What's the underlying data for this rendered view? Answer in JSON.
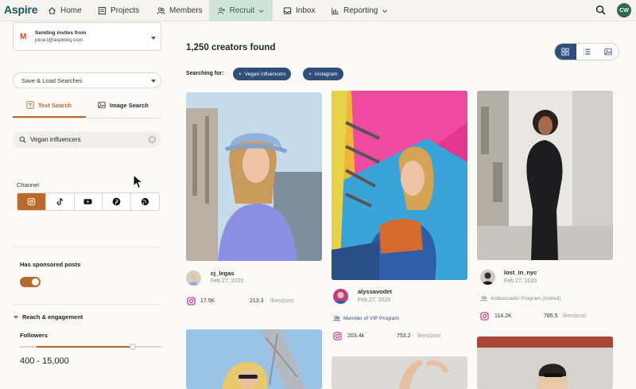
{
  "nav": {
    "brand": "Aspire",
    "items": [
      {
        "label": "Home"
      },
      {
        "label": "Projects"
      },
      {
        "label": "Members"
      },
      {
        "label": "Recruit"
      },
      {
        "label": "Inbox"
      },
      {
        "label": "Reporting"
      }
    ],
    "user_initials": "CW"
  },
  "sidebar": {
    "sender_title": "Sending invites from",
    "sender_email": "joice.l@aspireiq.com",
    "save_load": "Save & Load Searches",
    "tabs": [
      {
        "label": "Text Search"
      },
      {
        "label": "Image Search"
      }
    ],
    "search_value": "Vegan influencers",
    "channel_label": "Channel",
    "sponsored_label": "Has sponsored posts",
    "sponsored_on": true,
    "reach_label": "Reach & engagement",
    "followers_label": "Followers",
    "followers_range": "400 - 15,000",
    "followers_slider": {
      "low_fraction": 0.12,
      "high_fraction": 0.8
    }
  },
  "main": {
    "results_count": "1,250 creators found",
    "searching_for": "Searching for:",
    "chips": [
      {
        "label": "Vegan influencers"
      },
      {
        "label": "Instagram"
      }
    ],
    "cards": [
      {
        "username": "cj_legas",
        "date": "Feb 27, 2020",
        "followers": "17.5K",
        "likes": "213.3",
        "likes_unit": "likes/post"
      },
      {
        "username": "alyssavodet",
        "date": "Feb 27, 2020",
        "program": "Member of VIP Program",
        "followers": "203.4k",
        "likes": "753.2",
        "likes_unit": "likes/post"
      },
      {
        "username": "lost_in_nyc",
        "date": "Feb 27, 2020",
        "program": "Ambassador Program (Invited)",
        "followers": "114.2K",
        "likes": "785.5",
        "likes_unit": "likes/post"
      }
    ]
  },
  "colors": {
    "accent": "#b96a2e",
    "primary": "#2f4e7a",
    "brand": "#1a5462",
    "active_tab": "#cfe3d7"
  }
}
